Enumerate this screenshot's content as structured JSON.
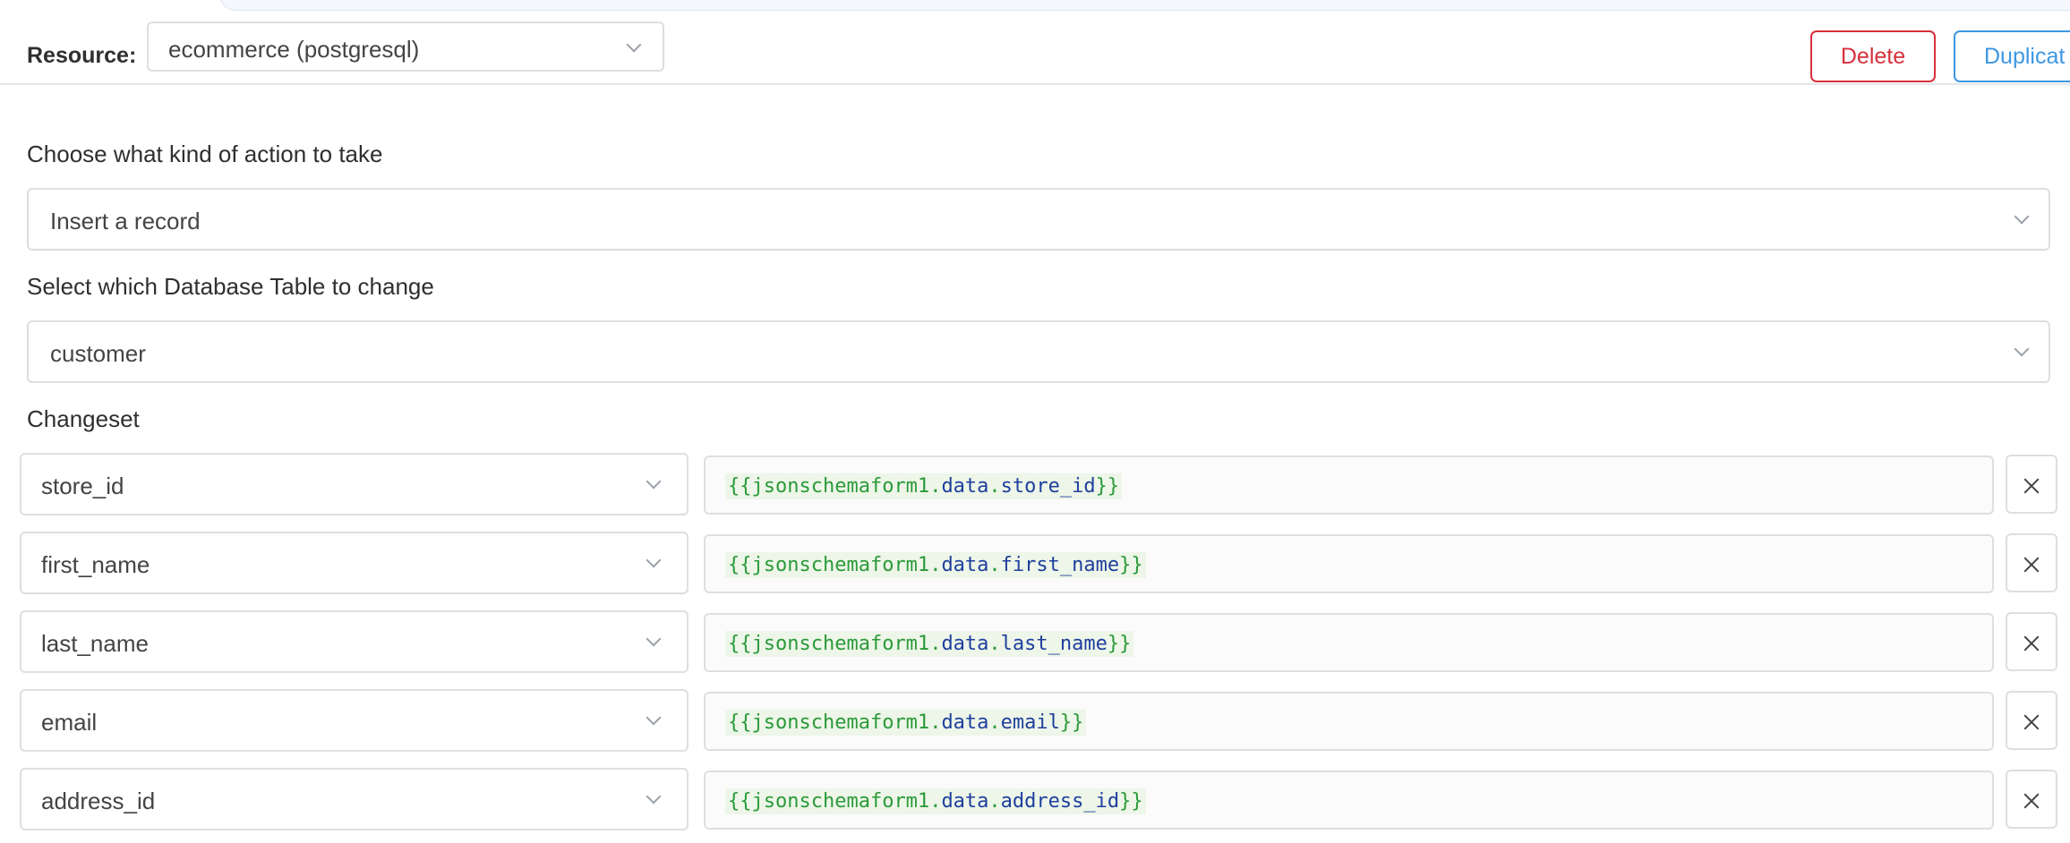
{
  "resource": {
    "label": "Resource:",
    "selected": "ecommerce (postgresql)"
  },
  "actions": {
    "delete_label": "Delete",
    "duplicate_label": "Duplicat"
  },
  "action_type": {
    "label": "Choose what kind of action to take",
    "selected": "Insert a record"
  },
  "table": {
    "label": "Select which Database Table to change",
    "selected": "customer"
  },
  "changeset": {
    "label": "Changeset",
    "rows": [
      {
        "field": "store_id",
        "open": "{{",
        "object": "jsonschemaform1",
        "dot1": ".",
        "data": "data",
        "dot2": ".",
        "prop": "store_id",
        "close": "}}"
      },
      {
        "field": "first_name",
        "open": "{{",
        "object": "jsonschemaform1",
        "dot1": ".",
        "data": "data",
        "dot2": ".",
        "prop": "first_name",
        "close": "}}"
      },
      {
        "field": "last_name",
        "open": "{{",
        "object": "jsonschemaform1",
        "dot1": ".",
        "data": "data",
        "dot2": ".",
        "prop": "last_name",
        "close": "}}"
      },
      {
        "field": "email",
        "open": "{{",
        "object": "jsonschemaform1",
        "dot1": ".",
        "data": "data",
        "dot2": ".",
        "prop": "email",
        "close": "}}"
      },
      {
        "field": "address_id",
        "open": "{{",
        "object": "jsonschemaform1",
        "dot1": ".",
        "data": "data",
        "dot2": ".",
        "prop": "address_id",
        "close": "}}"
      }
    ]
  },
  "icons": {
    "chevron": "chevron-down-icon",
    "remove": "close-icon"
  },
  "colors": {
    "delete": "#d6303b",
    "duplicate": "#3d97e3",
    "code_green": "#2b9a3a",
    "code_blue": "#1f3f9e"
  }
}
